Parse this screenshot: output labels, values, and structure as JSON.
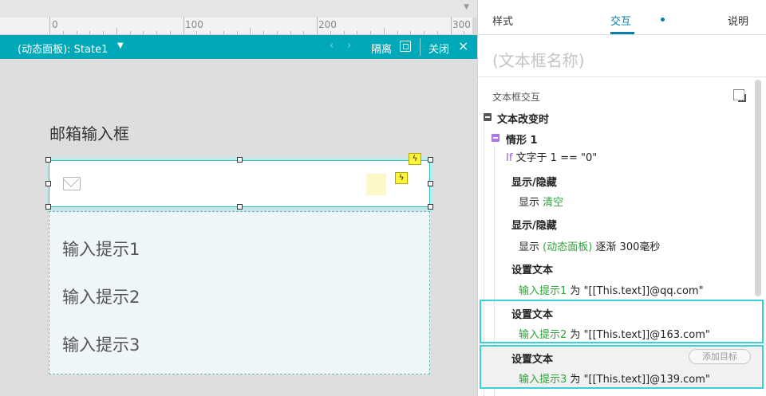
{
  "ruler": {
    "marks": [
      "0",
      "100",
      "200",
      "300"
    ]
  },
  "panel_bar": {
    "title": "(动态面板): State1",
    "isolate_label": "隔离",
    "close_label": "关闭",
    "bg_color": "#00a9b9"
  },
  "canvas": {
    "widget_label": "邮箱输入框",
    "hints": [
      "输入提示1",
      "输入提示2",
      "输入提示3"
    ]
  },
  "tabs": {
    "style": "样式",
    "interaction": "交互",
    "notes": "说明",
    "active": "interaction"
  },
  "widget_name_placeholder": "(文本框名称)",
  "interactions": {
    "section_title": "文本框交互",
    "event": "文本改变时",
    "case": "情形 1",
    "condition": {
      "keyword": "If",
      "text": " 文字于 1 == \"0\""
    },
    "actions": [
      {
        "title": "显示/隐藏",
        "verb": "显示 ",
        "target": "清空",
        "rest": ""
      },
      {
        "title": "显示/隐藏",
        "verb": "显示 ",
        "target": "(动态面板)",
        "rest": " 逐渐 300毫秒"
      },
      {
        "title": "设置文本",
        "verb": "",
        "target": "输入提示1",
        "rest": " 为 \"[[This.text]]@qq.com\""
      },
      {
        "title": "设置文本",
        "verb": "",
        "target": "输入提示2",
        "rest": " 为 \"[[This.text]]@163.com\""
      },
      {
        "title": "设置文本",
        "verb": "",
        "target": "输入提示3",
        "rest": " 为 \"[[This.text]]@139.com\""
      }
    ],
    "add_target": "添加目标"
  },
  "colors": {
    "accent": "#00a9b9",
    "selection": "#3ccfd7",
    "target_green": "#2ea33a",
    "condition_purple": "#9b59d8"
  }
}
